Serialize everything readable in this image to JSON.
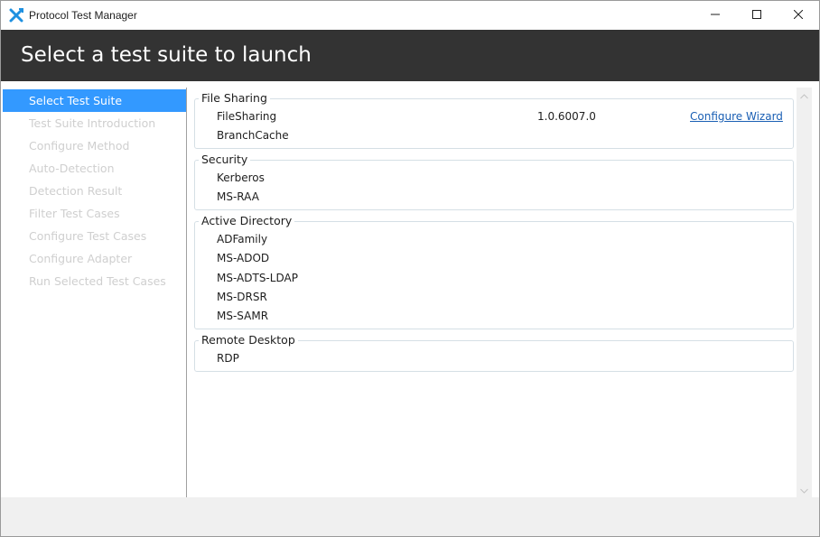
{
  "window": {
    "title": "Protocol Test Manager"
  },
  "header": {
    "title": "Select a test suite to launch"
  },
  "sidebar": {
    "items": [
      {
        "label": "Select Test Suite",
        "active": true
      },
      {
        "label": "Test Suite Introduction",
        "active": false
      },
      {
        "label": "Configure Method",
        "active": false
      },
      {
        "label": "Auto-Detection",
        "active": false
      },
      {
        "label": "Detection Result",
        "active": false
      },
      {
        "label": "Filter Test Cases",
        "active": false
      },
      {
        "label": "Configure Test Cases",
        "active": false
      },
      {
        "label": "Configure Adapter",
        "active": false
      },
      {
        "label": "Run Selected Test Cases",
        "active": false
      }
    ]
  },
  "groups": [
    {
      "label": "File Sharing",
      "suites": [
        {
          "name": "FileSharing",
          "version": "1.0.6007.0",
          "link": "Configure Wizard"
        },
        {
          "name": "BranchCache"
        }
      ]
    },
    {
      "label": "Security",
      "suites": [
        {
          "name": "Kerberos"
        },
        {
          "name": "MS-RAA"
        }
      ]
    },
    {
      "label": "Active Directory",
      "suites": [
        {
          "name": "ADFamily"
        },
        {
          "name": "MS-ADOD"
        },
        {
          "name": "MS-ADTS-LDAP"
        },
        {
          "name": "MS-DRSR"
        },
        {
          "name": "MS-SAMR"
        }
      ]
    },
    {
      "label": "Remote Desktop",
      "suites": [
        {
          "name": "RDP"
        }
      ]
    }
  ],
  "colors": {
    "header_bg": "#333333",
    "accent": "#3399ff",
    "link": "#1a5fb4",
    "disabled_text": "#cfcfcf"
  },
  "icons": {
    "app": "protocol-test-manager-icon",
    "minimize": "minimize-icon",
    "maximize": "maximize-icon",
    "close": "close-icon"
  }
}
